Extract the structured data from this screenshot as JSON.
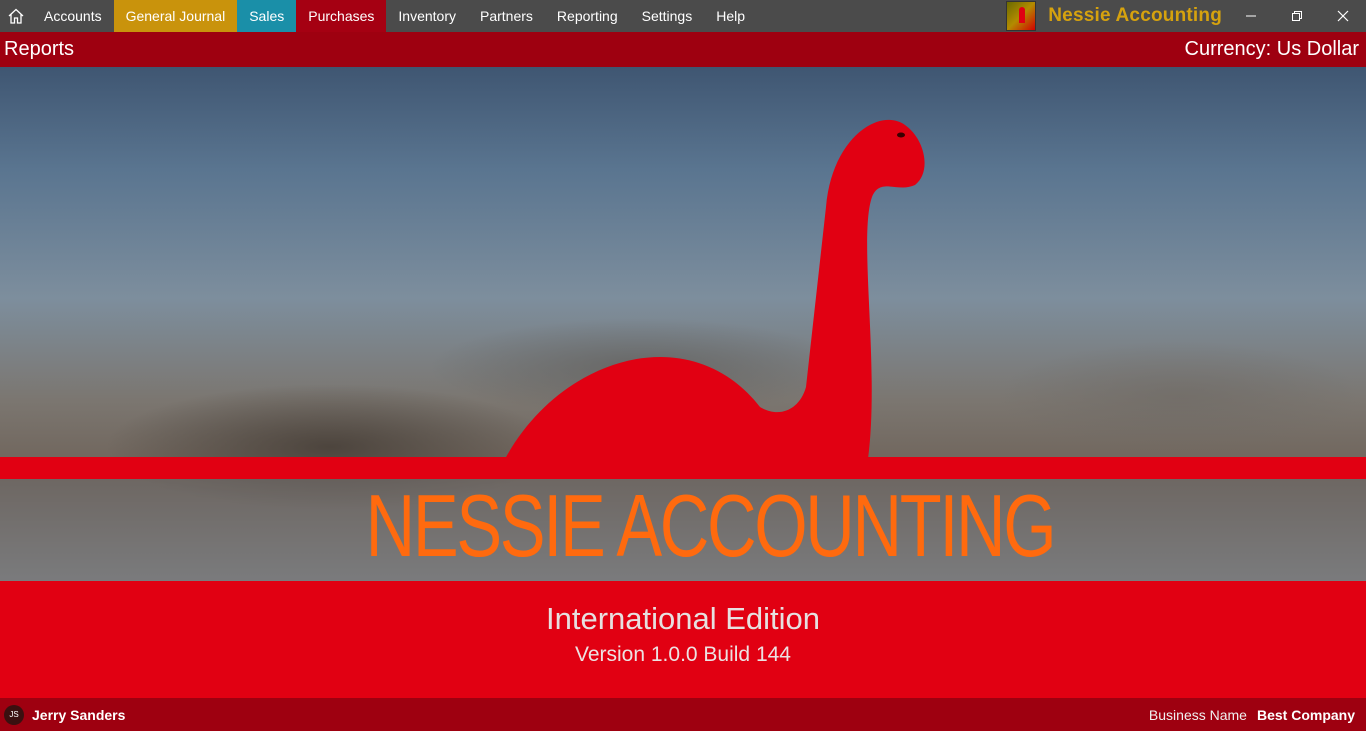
{
  "menu": {
    "items": [
      {
        "label": "Accounts"
      },
      {
        "label": "General Journal"
      },
      {
        "label": "Sales"
      },
      {
        "label": "Purchases"
      },
      {
        "label": "Inventory"
      },
      {
        "label": "Partners"
      },
      {
        "label": "Reporting"
      },
      {
        "label": "Settings"
      },
      {
        "label": "Help"
      }
    ],
    "brand_name": "Nessie Accounting",
    "window_controls": {
      "minimize": "–",
      "restore": "❐",
      "close": "✕"
    }
  },
  "header": {
    "title": "Reports",
    "currency": "Currency: Us Dollar"
  },
  "hero": {
    "logo_text": "NESSIE ACCOUNTING"
  },
  "edition": {
    "title": "International Edition",
    "version": "Version 1.0.0 Build 144"
  },
  "status": {
    "user_initials": "JS",
    "user_name": "Jerry Sanders",
    "business_label": "Business Name",
    "business_value": "Best Company"
  },
  "colors": {
    "menubar": "#4b4b4b",
    "general_journal": "#c9930c",
    "sales": "#1a8fa8",
    "purchases": "#a50012",
    "header_red": "#9e0010",
    "brand_red": "#e10012",
    "logo_orange": "#ff6a0e",
    "brand_gold": "#d6a20e"
  }
}
